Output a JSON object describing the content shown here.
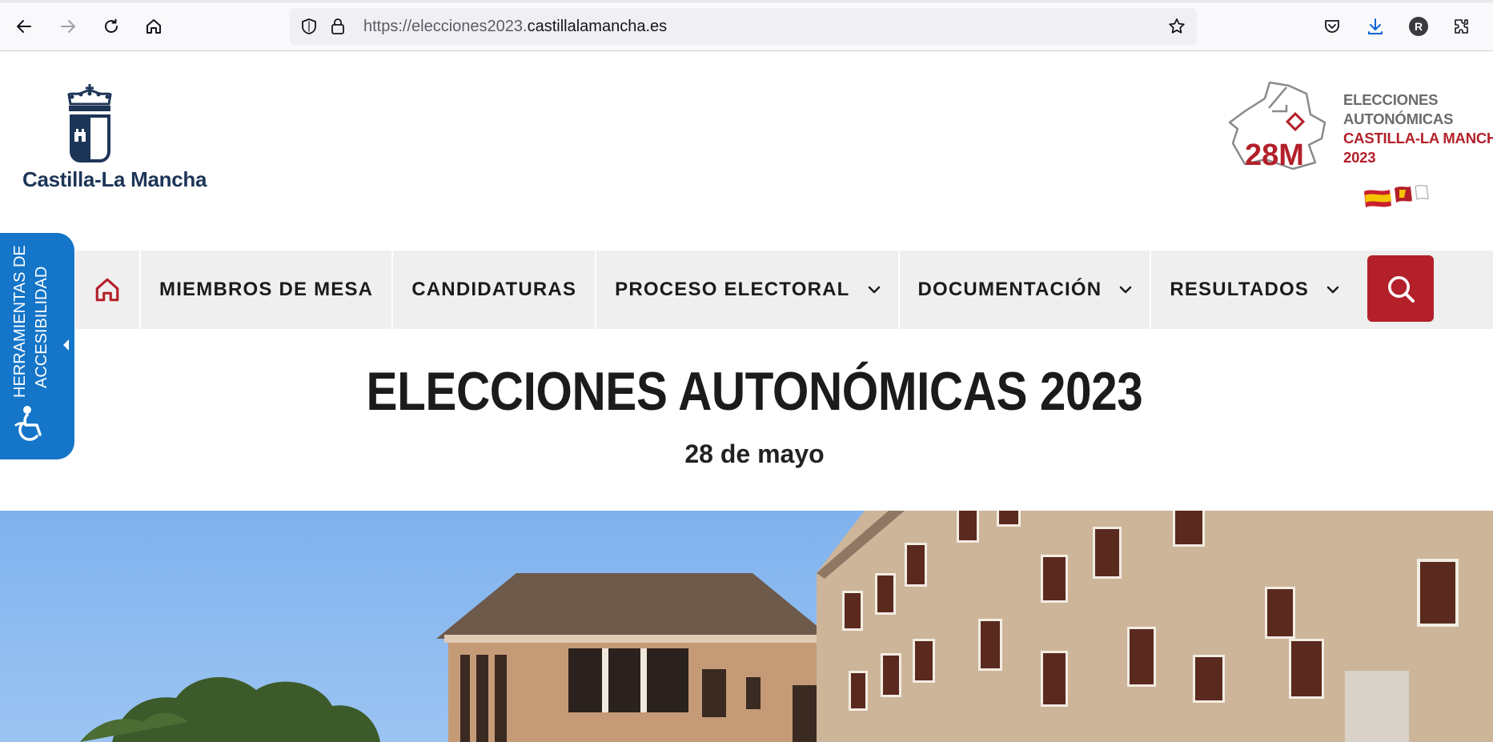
{
  "browser": {
    "url_prefix": "https://elecciones2023.",
    "url_domain": "castillalamancha.es",
    "profile_initial": "R"
  },
  "header": {
    "logo_text": "Castilla-La Mancha",
    "election_logo": {
      "badge": "28M",
      "lines": [
        "ELECCIONES",
        "AUTONÓMICAS",
        "CASTILLA-LA MANCHA",
        "2023"
      ]
    }
  },
  "nav": {
    "items": [
      {
        "label": "MIEMBROS DE MESA",
        "dropdown": false
      },
      {
        "label": "CANDIDATURAS",
        "dropdown": false
      },
      {
        "label": "PROCESO ELECTORAL",
        "dropdown": true
      },
      {
        "label": "DOCUMENTACIÓN",
        "dropdown": true
      },
      {
        "label": "RESULTADOS",
        "dropdown": true
      }
    ]
  },
  "accessibility": {
    "line1": "HERRAMIENTAS DE",
    "line2": "ACCESIBILIDAD"
  },
  "main": {
    "title": "ELECCIONES AUTONÓMICAS 2023",
    "subtitle": "28 de mayo"
  },
  "colors": {
    "accent_red": "#b3202a",
    "accessibility_blue": "#1575c8",
    "nav_bg": "#efefef"
  }
}
